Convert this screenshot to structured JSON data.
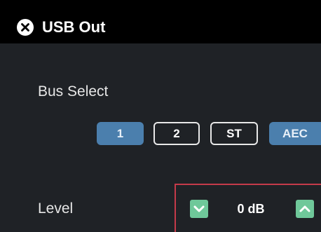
{
  "window": {
    "title": "USB Out",
    "close_icon": "close-circle-icon"
  },
  "bus_select": {
    "label": "Bus Select",
    "buttons": [
      {
        "label": "1",
        "active": true
      },
      {
        "label": "2",
        "active": false
      },
      {
        "label": "ST",
        "active": false
      },
      {
        "label": "AEC",
        "active": true
      }
    ]
  },
  "level": {
    "label": "Level",
    "value": "0 dB",
    "decrease_icon": "chevron-down-icon",
    "increase_icon": "chevron-up-icon"
  },
  "colors": {
    "titlebar": "#000000",
    "background": "#1f2226",
    "active_button": "#4b7fad",
    "stepper_button": "#6fc89a",
    "highlight_border": "#c43a4a"
  }
}
